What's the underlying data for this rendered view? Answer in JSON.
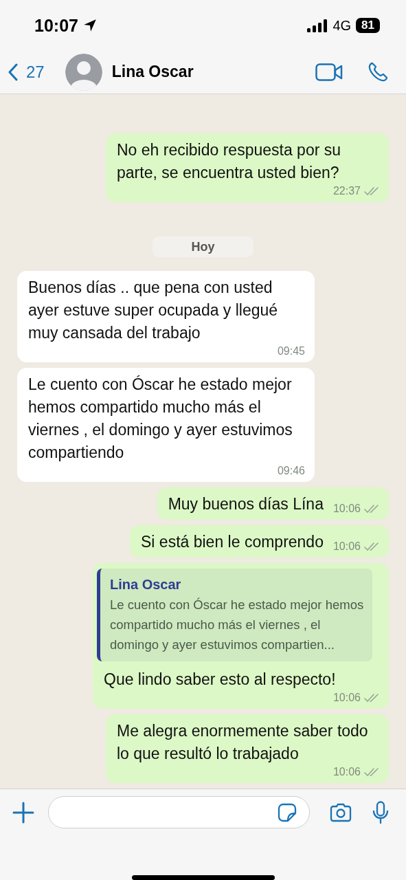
{
  "status_bar": {
    "time": "10:07",
    "network": "4G",
    "battery": "81"
  },
  "header": {
    "back_count": "27",
    "contact_name": "Lina Oscar"
  },
  "messages": [
    {
      "kind": "outgoing",
      "text": "No eh recibido respuesta por su parte, se encuentra usted bien?",
      "time": "22:37",
      "read": false
    },
    {
      "kind": "date",
      "text": "Hoy"
    },
    {
      "kind": "incoming",
      "text": "Buenos días .. que pena con usted ayer estuve super ocupada y llegué muy cansada del trabajo",
      "time": "09:45"
    },
    {
      "kind": "incoming",
      "text": "Le cuento con Óscar he estado mejor hemos compartido mucho más el viernes , el domingo y ayer estuvimos compartiendo",
      "time": "09:46"
    },
    {
      "kind": "outgoing",
      "text": "Muy buenos días Lína",
      "time": "10:06",
      "read": false
    },
    {
      "kind": "outgoing",
      "text": "Si está bien le comprendo",
      "time": "10:06",
      "read": false
    },
    {
      "kind": "outgoing",
      "reply_to": {
        "name": "Lina Oscar",
        "text": "Le cuento con Óscar he estado mejor hemos compartido mucho más el viernes , el domingo y ayer estuvimos compartien..."
      },
      "text": "Que lindo saber esto al respecto!",
      "time": "10:06",
      "read": false
    },
    {
      "kind": "outgoing",
      "text": "Me alegra enormemente saber todo lo que resultó lo trabajado",
      "time": "10:06",
      "read": false
    }
  ]
}
